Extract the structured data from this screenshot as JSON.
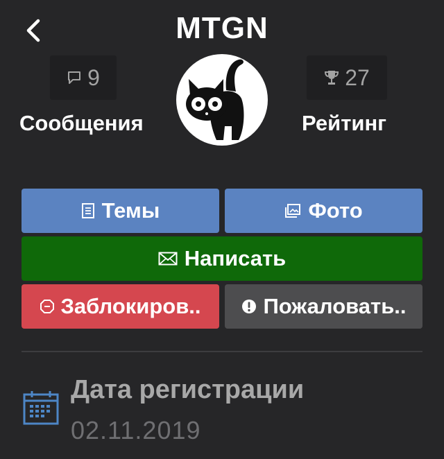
{
  "header": {
    "title": "MTGN"
  },
  "stats": {
    "messages": {
      "count": "9",
      "label": "Сообщения",
      "icon": "speech-bubble-icon"
    },
    "rating": {
      "count": "27",
      "label": "Рейтинг",
      "icon": "trophy-icon"
    }
  },
  "avatar": {
    "icon": "black-cat-avatar"
  },
  "actions": {
    "topics": {
      "label": "Темы",
      "icon": "document-icon"
    },
    "photo": {
      "label": "Фото",
      "icon": "photos-icon"
    },
    "write": {
      "label": "Написать",
      "icon": "envelope-icon"
    },
    "block": {
      "label": "Заблокиров..",
      "icon": "stop-octagon-icon"
    },
    "report": {
      "label": "Пожаловать..",
      "icon": "exclamation-circle-icon"
    }
  },
  "info": {
    "registration_label": "Дата регистрации",
    "registration_date": "02.11.2019",
    "icon": "calendar-icon"
  },
  "colors": {
    "background": "#262628",
    "stat_box": "#1f1f21",
    "blue_button": "#5b83c1",
    "green_button": "#0f6909",
    "red_button": "#d5474f",
    "gray_button": "#4d4d4f",
    "calendar_blue": "#4d86c6"
  }
}
